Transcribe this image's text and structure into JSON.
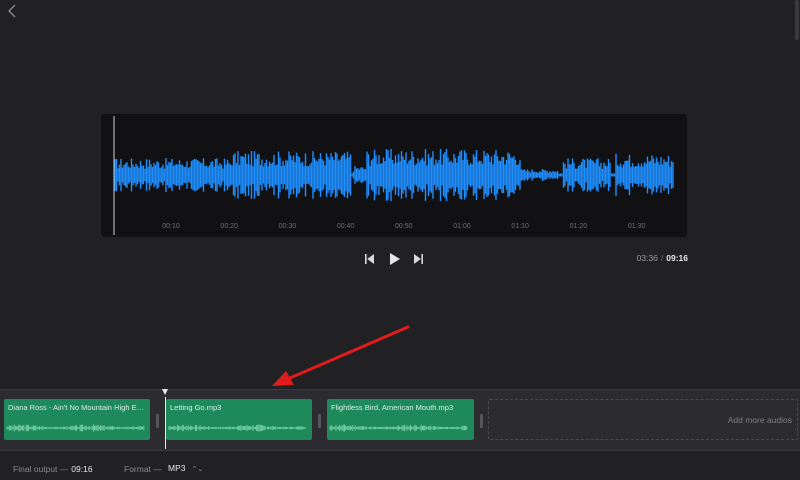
{
  "colors": {
    "background": "#212124",
    "waveform": "#1e8fff",
    "clip": "#1e8a5c",
    "annotation_arrow": "#e01b1b"
  },
  "icons": {
    "back": "chevron-left-icon",
    "previous": "skip-back-icon",
    "play": "play-icon",
    "next": "skip-forward-icon",
    "format_chevron": "up-down-chevron-icon"
  },
  "waveform": {
    "tick_labels": [
      "00:10",
      "00:20",
      "00:30",
      "00:40",
      "00:50",
      "01:00",
      "01:10",
      "01:20",
      "01:30"
    ]
  },
  "player": {
    "current_time": "03:36",
    "separator": "/",
    "total_time": "09:16"
  },
  "timeline": {
    "clips": [
      {
        "title": "Diana Ross - Ain't No Mountain High Eno..."
      },
      {
        "title": "Letting Go.mp3"
      },
      {
        "title": "Flightless Bird, American Mouth.mp3"
      }
    ],
    "add_more_label": "Add more audios"
  },
  "footer": {
    "final_output_label": "Final output —",
    "final_output_value": "09:16",
    "format_label": "Format —",
    "format_value": "MP3",
    "format_chevron": "⌃⌄"
  }
}
